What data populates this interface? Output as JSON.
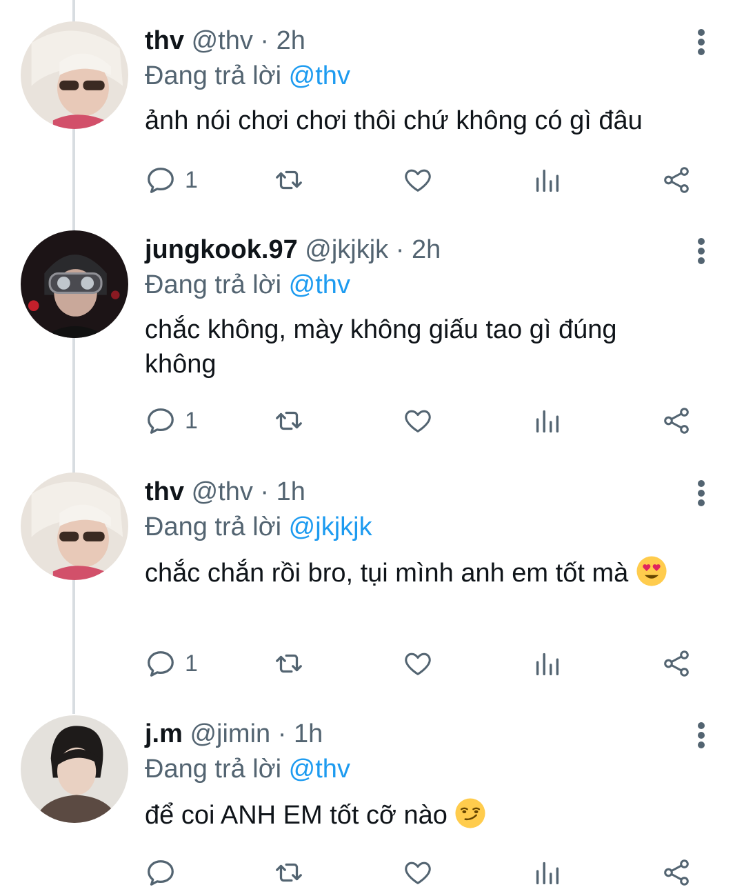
{
  "reply_prefix": "Đang trả lời",
  "tweets": [
    {
      "name": "thv",
      "handle": "@thv",
      "separator": "·",
      "time": "2h",
      "reply_to": "@thv",
      "text": "ảnh nói chơi chơi thôi chứ không có gì đâu",
      "emoji": "",
      "reply_count": "1",
      "avatar": "avatar-thv"
    },
    {
      "name": "jungkook.97",
      "handle": "@jkjkjk",
      "separator": "·",
      "time": "2h",
      "reply_to": "@thv",
      "text": "chắc không, mày không giấu tao gì đúng không",
      "emoji": "",
      "reply_count": "1",
      "avatar": "avatar-jungkook"
    },
    {
      "name": "thv",
      "handle": "@thv",
      "separator": "·",
      "time": "1h",
      "reply_to": "@jkjkjk",
      "text": "chắc chắn rồi bro, tụi mình anh em tốt mà",
      "emoji": "heart-eyes-emoji",
      "reply_count": "1",
      "avatar": "avatar-thv"
    },
    {
      "name": "j.m",
      "handle": "@jimin",
      "separator": "·",
      "time": "1h",
      "reply_to": "@thv",
      "text": "để coi ANH EM tốt cỡ nào",
      "emoji": "smirk-emoji",
      "reply_count": "",
      "avatar": "avatar-jimin"
    }
  ],
  "icons": {
    "reply": "reply-icon",
    "retweet": "retweet-icon",
    "like": "heart-icon",
    "views": "analytics-icon",
    "share": "share-icon",
    "more": "more-vertical-icon"
  },
  "colors": {
    "mention": "#1d9bf0",
    "secondary": "#536471",
    "thread_line": "#d8dde1"
  }
}
